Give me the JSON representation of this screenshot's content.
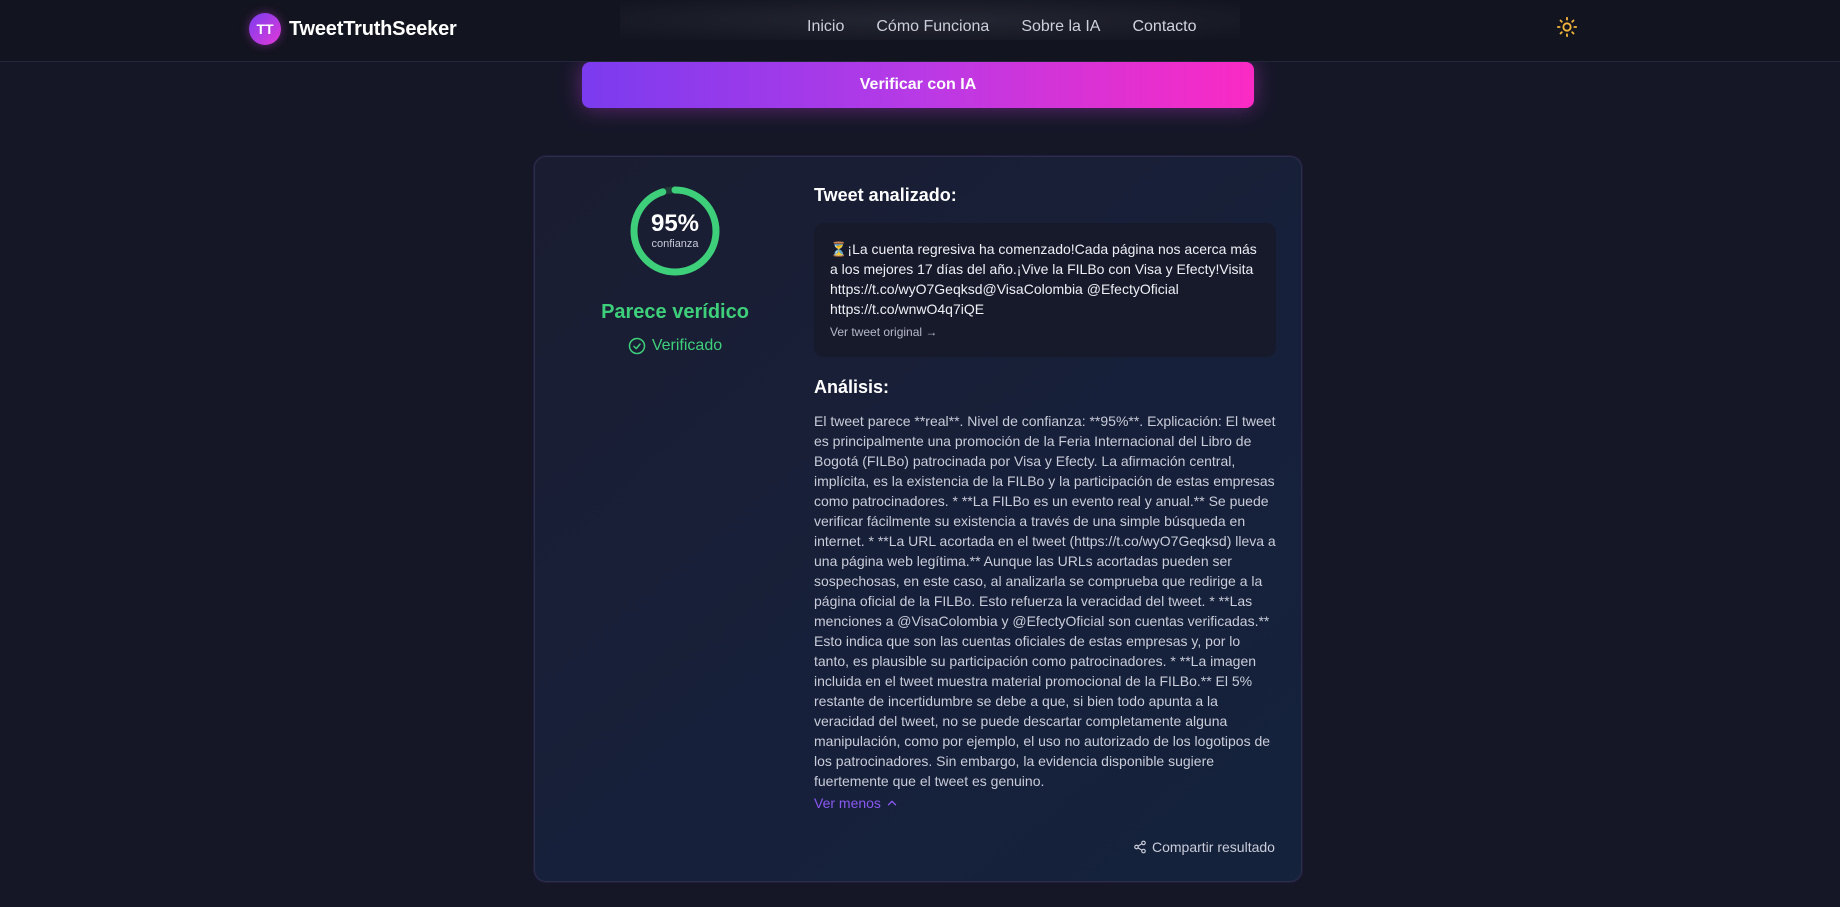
{
  "header": {
    "brand_initials": "TT",
    "brand_name": "TweetTruthSeeker",
    "nav": [
      "Inicio",
      "Cómo Funciona",
      "Sobre la IA",
      "Contacto"
    ],
    "theme_icon": "sun-icon"
  },
  "verify": {
    "button_label": "Verificar con IA"
  },
  "result": {
    "confidence_percent": 95,
    "confidence_text": "95%",
    "confidence_label": "confianza",
    "verdict": "Parece verídico",
    "status": "Verificado",
    "tweet_title": "Tweet analizado:",
    "tweet_text": "⏳¡La cuenta regresiva ha comenzado!Cada página nos acerca más a los mejores 17 días del año.¡Vive la FILBo con Visa y Efecty!Visita https://t.co/wyO7Geqksd@VisaColombia @EfectyOficial https://t.co/wnwO4q7iQE",
    "tweet_link": "Ver tweet original →",
    "analysis_title": "Análisis:",
    "analysis_text": "El tweet parece **real**. Nivel de confianza: **95%**. Explicación: El tweet es principalmente una promoción de la Feria Internacional del Libro de Bogotá (FILBo) patrocinada por Visa y Efecty. La afirmación central, implícita, es la existencia de la FILBo y la participación de estas empresas como patrocinadores. * **La FILBo es un evento real y anual.** Se puede verificar fácilmente su existencia a través de una simple búsqueda en internet. * **La URL acortada en el tweet (https://t.co/wyO7Geqksd) lleva a una página web legítima.** Aunque las URLs acortadas pueden ser sospechosas, en este caso, al analizarla se comprueba que redirige a la página oficial de la FILBo. Esto refuerza la veracidad del tweet. * **Las menciones a @VisaColombia y @EfectyOficial son cuentas verificadas.** Esto indica que son las cuentas oficiales de estas empresas y, por lo tanto, es plausible su participación como patrocinadores. * **La imagen incluida en el tweet muestra material promocional de la FILBo.** El 5% restante de incertidumbre se debe a que, si bien todo apunta a la veracidad del tweet, no se puede descartar completamente alguna manipulación, como por ejemplo, el uso no autorizado de los logotipos de los patrocinadores. Sin embargo, la evidencia disponible sugiere fuertemente que el tweet es genuino.",
    "toggle_label": "Ver menos",
    "share_label": "Compartir resultado"
  },
  "colors": {
    "accent_purple": "#7b3bef",
    "accent_pink": "#fb2ac4",
    "success_green": "#3ecf7a",
    "background": "#151727"
  }
}
